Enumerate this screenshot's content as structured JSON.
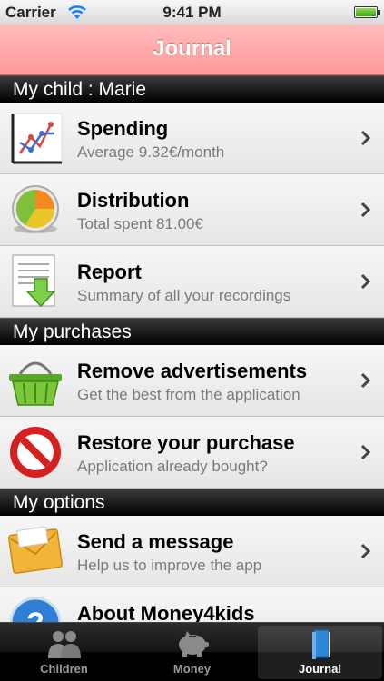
{
  "status_bar": {
    "carrier": "Carrier",
    "time": "9:41 PM"
  },
  "nav_bar": {
    "title": "Journal"
  },
  "sections": [
    {
      "header": "My child : Marie",
      "items": [
        {
          "title": "Spending",
          "subtitle": "Average 9.32€/month",
          "icon": "line-chart-icon"
        },
        {
          "title": "Distribution",
          "subtitle": "Total spent 81.00€",
          "icon": "pie-chart-icon"
        },
        {
          "title": "Report",
          "subtitle": "Summary of all your recordings",
          "icon": "report-download-icon"
        }
      ]
    },
    {
      "header": "My purchases",
      "items": [
        {
          "title": "Remove advertisements",
          "subtitle": "Get the best from the application",
          "icon": "shopping-basket-icon"
        },
        {
          "title": "Restore your purchase",
          "subtitle": "Application already bought?",
          "icon": "prohibited-icon"
        }
      ]
    },
    {
      "header": "My options",
      "items": [
        {
          "title": "Send a message",
          "subtitle": "Help us to improve the app",
          "icon": "envelope-icon"
        },
        {
          "title": "About Money4kids",
          "subtitle": "",
          "icon": "help-icon"
        }
      ]
    }
  ],
  "tab_bar": {
    "tabs": [
      {
        "label": "Children",
        "icon": "people-icon",
        "active": false
      },
      {
        "label": "Money",
        "icon": "piggy-bank-icon",
        "active": false
      },
      {
        "label": "Journal",
        "icon": "book-icon",
        "active": true
      }
    ]
  },
  "colors": {
    "nav_bar": "#ff9e9e",
    "section_header": "#111111",
    "cell_background": "#eeeeee",
    "active_tab_label": "#ffffff"
  }
}
